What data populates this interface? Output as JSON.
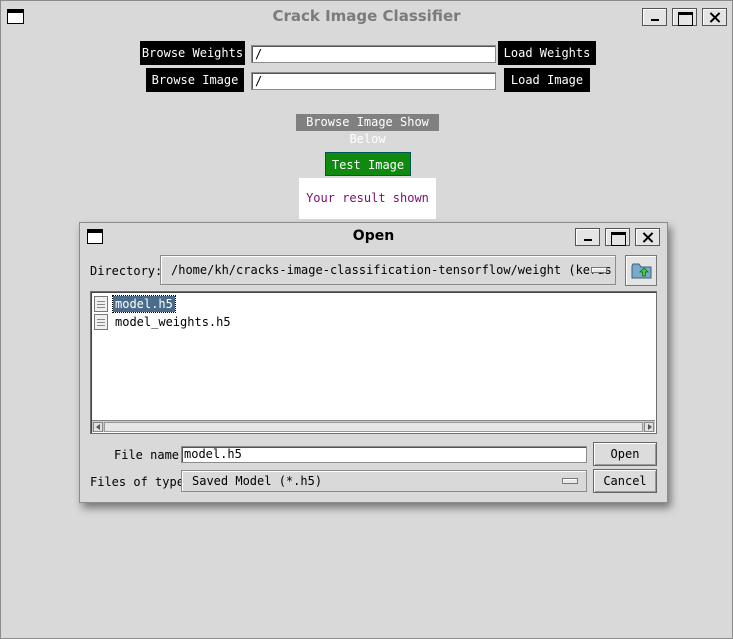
{
  "app": {
    "title": "Crack Image Classifier",
    "browse_weights_label": "Browse Weights",
    "weights_path": "/",
    "load_weights_label": "Load Weights",
    "browse_image_label": "Browse Image",
    "image_path": "/",
    "load_image_label": "Load Image",
    "image_placeholder_label": "Browse Image Show Below",
    "test_image_label": "Test Image",
    "result_text": "Your result shown here"
  },
  "dialog": {
    "title": "Open",
    "directory_label": "Directory:",
    "directory_value": "/home/kh/cracks-image-classification-tensorflow/weight (keras model)",
    "files": [
      {
        "name": "model.h5",
        "selected": true
      },
      {
        "name": "model_weights.h5",
        "selected": false
      }
    ],
    "file_name_label": "File name:",
    "file_name_value": "model.h5",
    "files_of_type_label": "Files of type:",
    "files_of_type_value": "Saved Model (*.h5)",
    "open_label": "Open",
    "cancel_label": "Cancel"
  }
}
